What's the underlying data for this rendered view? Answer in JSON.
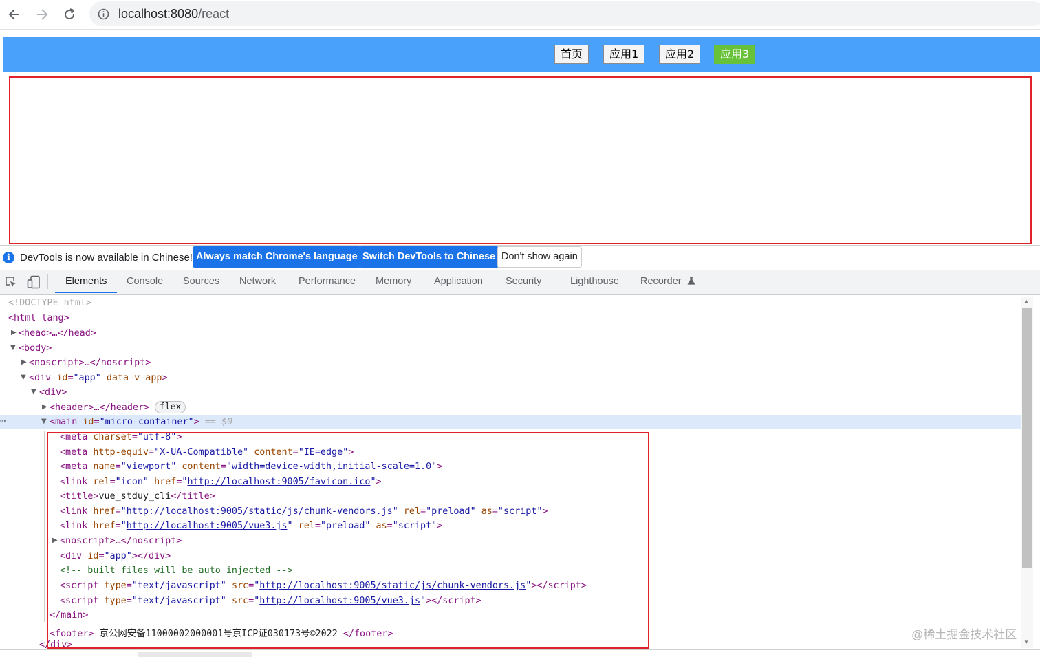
{
  "browser": {
    "url_host": "localhost:8080",
    "url_path": "/react"
  },
  "page": {
    "nav": [
      "首页",
      "应用1",
      "应用2",
      "应用3"
    ],
    "active_nav": "应用3"
  },
  "banner": {
    "message": "DevTools is now available in Chinese!",
    "always_match": "Always match Chrome's language",
    "switch": "Switch DevTools to Chinese",
    "dont_show": "Don't show again"
  },
  "devtools_tabs": [
    "Elements",
    "Console",
    "Sources",
    "Network",
    "Performance",
    "Memory",
    "Application",
    "Security",
    "Lighthouse",
    "Recorder"
  ],
  "elements": {
    "doctype": "<!DOCTYPE html>",
    "html_open": "<html lang>",
    "head": "<head>…</head>",
    "body_open": "<body>",
    "noscript": "<noscript>…</noscript>",
    "div_app_prefix": "<div ",
    "div_app_id_attr": "id",
    "div_app_id_val": "\"app\"",
    "div_app_v_attr": "data-v-app",
    "div_open": "<div>",
    "header": "<header>…</header>",
    "flex_badge": "flex",
    "main_prefix": "<main ",
    "main_id_attr": "id",
    "main_id_val": "\"micro-container\"",
    "main_suffix": ">",
    "selected_marker": " == $0",
    "meta1": {
      "attr": "charset",
      "val": "\"utf-8\""
    },
    "meta2": {
      "attr1": "http-equiv",
      "val1": "\"X-UA-Compatible\"",
      "attr2": "content",
      "val2": "\"IE=edge\""
    },
    "meta3": {
      "attr1": "name",
      "val1": "\"viewport\"",
      "attr2": "content",
      "val2": "\"width=device-width,initial-scale=1.0\""
    },
    "link_icon": {
      "attr1": "rel",
      "val1": "\"icon\"",
      "attr2": "href",
      "url": "http://localhost:9005/favicon.ico"
    },
    "title": {
      "open": "<title>",
      "text": "vue_stduy_cli",
      "close": "</title>"
    },
    "link_vendors": {
      "url": "http://localhost:9005/static/js/chunk-vendors.js",
      "rel_val": "\"preload\"",
      "as_val": "\"script\""
    },
    "link_vue3": {
      "url": "http://localhost:9005/vue3.js",
      "rel_val": "\"preload\"",
      "as_val": "\"script\""
    },
    "noscript2": "<noscript>…</noscript>",
    "div_app2": {
      "attr": "id",
      "val": "\"app\""
    },
    "comment": "<!-- built files will be auto injected -->",
    "script_type_val": "\"text/javascript\"",
    "script_vendors_url": "http://localhost:9005/static/js/chunk-vendors.js",
    "script_vue3_url": "http://localhost:9005/vue3.js",
    "main_close": "</main>",
    "footer_text": " 京公网安备11000002000001号京ICP证030173号©2022 ",
    "div_close": "</div>"
  },
  "watermark": "@稀土掘金技术社区",
  "colors": {
    "header_blue": "#4aa1fb",
    "active_green": "#67c23a",
    "highlight_red": "#e0222a",
    "devtools_blue": "#1a73e8"
  }
}
